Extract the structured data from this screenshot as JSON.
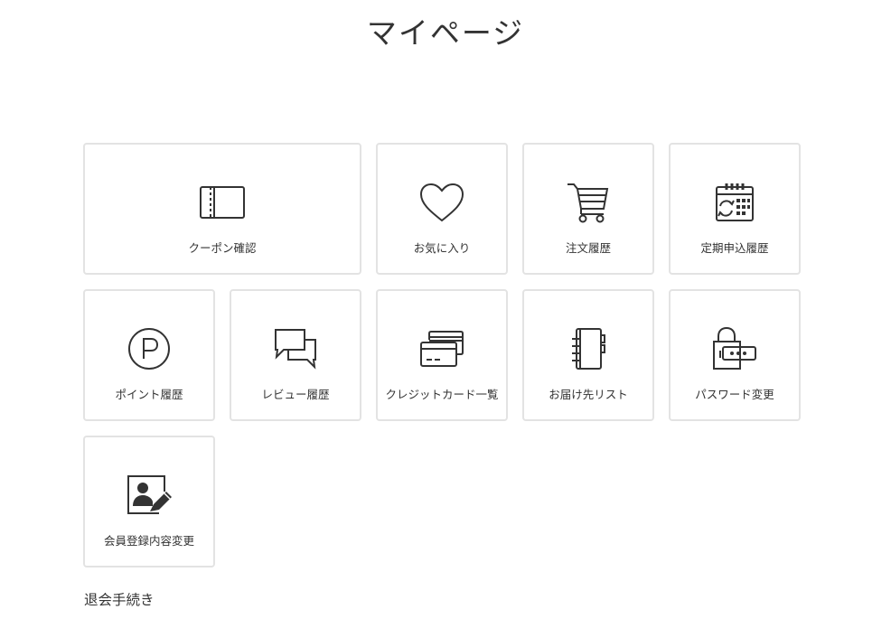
{
  "page": {
    "title": "マイページ"
  },
  "menu": {
    "coupon": "クーポン確認",
    "favorites": "お気に入り",
    "order_history": "注文履歴",
    "subscription_history": "定期申込履歴",
    "point_history": "ポイント履歴",
    "review_history": "レビュー履歴",
    "credit_cards": "クレジットカード一覧",
    "address_list": "お届け先リスト",
    "password_change": "パスワード変更",
    "member_info_change": "会員登録内容変更"
  },
  "footer": {
    "withdraw": "退会手続き"
  },
  "icons": {
    "coupon": "ticket-icon",
    "favorites": "heart-icon",
    "order_history": "cart-icon",
    "subscription_history": "calendar-refresh-icon",
    "point_history": "point-p-icon",
    "review_history": "chat-bubbles-icon",
    "credit_cards": "credit-cards-icon",
    "address_list": "address-book-icon",
    "password_change": "lock-password-icon",
    "member_info_change": "user-edit-icon"
  },
  "colors": {
    "text": "#333333",
    "tile_border": "#e3e3e3",
    "icon_stroke": "#333333"
  }
}
